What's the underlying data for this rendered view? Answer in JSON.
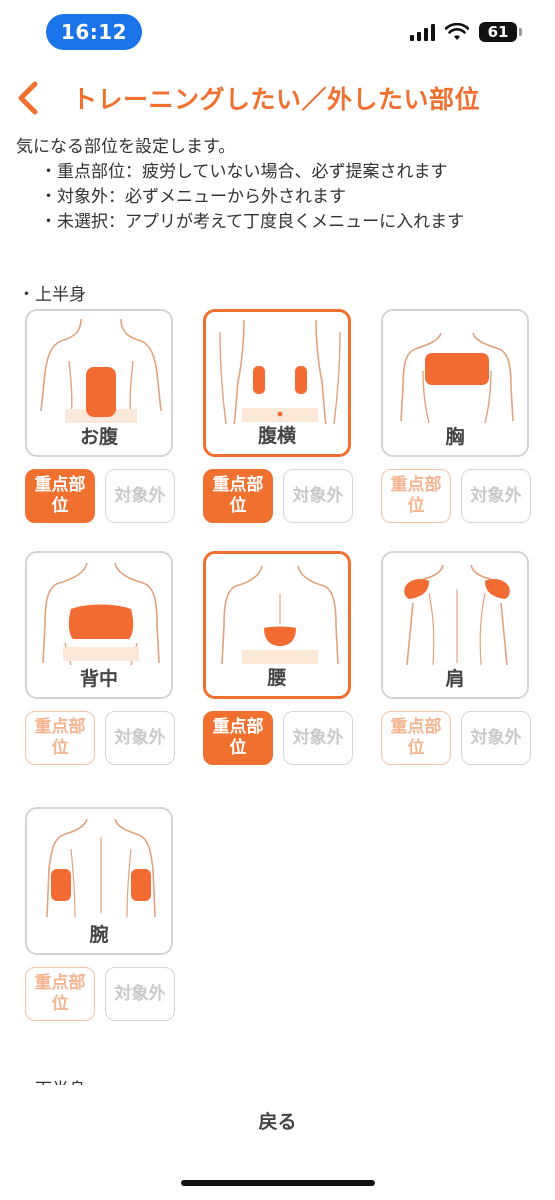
{
  "status": {
    "time": "16:12",
    "battery": "61"
  },
  "header": {
    "title": "トレーニングしたい／外したい部位"
  },
  "description": {
    "intro": "気になる部位を設定します。",
    "rules": [
      "・重点部位：疲労していない場合、必ず提案されます",
      "・対象外：必ずメニューから外されます",
      "・未選択：アプリが考えて丁度良くメニューに入れます"
    ]
  },
  "upper_body": {
    "label": "・上半身",
    "parts": [
      {
        "name": "お腹",
        "selected": true,
        "focus": true,
        "exclude": false
      },
      {
        "name": "腹横",
        "selected": true,
        "focus": true,
        "exclude": false
      },
      {
        "name": "胸",
        "selected": false,
        "focus": false,
        "exclude": false
      },
      {
        "name": "背中",
        "selected": false,
        "focus": false,
        "exclude": false
      },
      {
        "name": "腰",
        "selected": true,
        "focus": true,
        "exclude": false
      },
      {
        "name": "肩",
        "selected": false,
        "focus": false,
        "exclude": false
      },
      {
        "name": "腕",
        "selected": false,
        "focus": false,
        "exclude": false
      }
    ],
    "focus_label": "重点部位",
    "exclude_label": "対象外"
  },
  "lower_body": {
    "label": "・下半身"
  },
  "footer": {
    "return_label": "戻る"
  },
  "colors": {
    "accent": "#f07030",
    "highlight": "#f26b33",
    "skin_tint": "#fbe8d8"
  }
}
